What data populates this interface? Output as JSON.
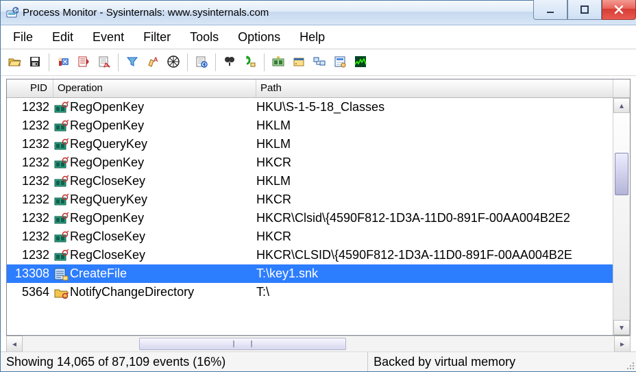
{
  "window": {
    "title": "Process Monitor - Sysinternals: www.sysinternals.com"
  },
  "menu": {
    "items": [
      "File",
      "Edit",
      "Event",
      "Filter",
      "Tools",
      "Options",
      "Help"
    ]
  },
  "toolbar": {
    "groups": [
      [
        "open",
        "save"
      ],
      [
        "capture",
        "autoscroll",
        "clear"
      ],
      [
        "filter",
        "highlight",
        "process-tree"
      ],
      [
        "include-process"
      ],
      [
        "find",
        "jump-to"
      ],
      [
        "show-registry",
        "show-filesystem",
        "show-network",
        "show-process",
        "show-profiling"
      ]
    ],
    "icons": {
      "open": "open-icon",
      "save": "save-icon",
      "capture": "capture-icon",
      "autoscroll": "autoscroll-icon",
      "clear": "clear-icon",
      "filter": "filter-icon",
      "highlight": "highlight-icon",
      "process-tree": "process-tree-icon",
      "include-process": "include-process-icon",
      "find": "find-icon",
      "jump-to": "jump-to-icon",
      "show-registry": "registry-icon",
      "show-filesystem": "filesystem-icon",
      "show-network": "network-icon",
      "show-process": "process-icon",
      "show-profiling": "profiling-icon"
    }
  },
  "columns": {
    "pid": "PID",
    "operation": "Operation",
    "path": "Path"
  },
  "events": [
    {
      "pid": 1232,
      "op": "RegOpenKey",
      "icon": "registry",
      "path": "HKU\\S-1-5-18_Classes",
      "selected": false
    },
    {
      "pid": 1232,
      "op": "RegOpenKey",
      "icon": "registry",
      "path": "HKLM",
      "selected": false
    },
    {
      "pid": 1232,
      "op": "RegQueryKey",
      "icon": "registry",
      "path": "HKLM",
      "selected": false
    },
    {
      "pid": 1232,
      "op": "RegOpenKey",
      "icon": "registry",
      "path": "HKCR",
      "selected": false
    },
    {
      "pid": 1232,
      "op": "RegCloseKey",
      "icon": "registry",
      "path": "HKLM",
      "selected": false
    },
    {
      "pid": 1232,
      "op": "RegQueryKey",
      "icon": "registry",
      "path": "HKCR",
      "selected": false
    },
    {
      "pid": 1232,
      "op": "RegOpenKey",
      "icon": "registry",
      "path": "HKCR\\Clsid\\{4590F812-1D3A-11D0-891F-00AA004B2E2",
      "selected": false
    },
    {
      "pid": 1232,
      "op": "RegCloseKey",
      "icon": "registry",
      "path": "HKCR",
      "selected": false
    },
    {
      "pid": 1232,
      "op": "RegCloseKey",
      "icon": "registry",
      "path": "HKCR\\CLSID\\{4590F812-1D3A-11D0-891F-00AA004B2E",
      "selected": false
    },
    {
      "pid": 13308,
      "op": "CreateFile",
      "icon": "file",
      "path": "T:\\key1.snk",
      "selected": true
    },
    {
      "pid": 5364,
      "op": "NotifyChangeDirectory",
      "icon": "folder",
      "path": "T:\\",
      "selected": false
    }
  ],
  "status": {
    "left": "Showing 14,065 of 87,109 events (16%)",
    "right": "Backed by virtual memory"
  }
}
